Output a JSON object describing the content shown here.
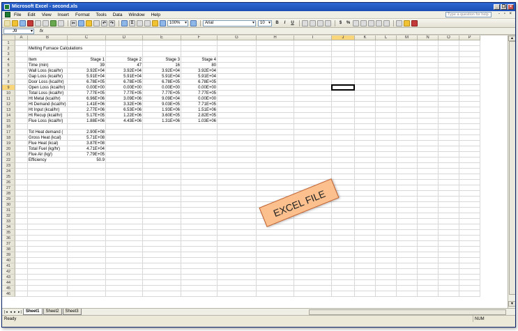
{
  "window": {
    "title": "Microsoft Excel - second.xls"
  },
  "menu": {
    "items": [
      "File",
      "Edit",
      "View",
      "Insert",
      "Format",
      "Tools",
      "Data",
      "Window",
      "Help"
    ],
    "help_placeholder": "Type a question for help"
  },
  "toolbar": {
    "zoom": "100%",
    "font": "Arial",
    "font_size": "10",
    "buttons": {
      "bold": "B",
      "italic": "I",
      "underline": "U",
      "currency": "$",
      "percent": "%"
    }
  },
  "formula_bar": {
    "name_box": "J9",
    "fx": "fx",
    "content": ""
  },
  "columns": [
    {
      "label": "A",
      "w": 18
    },
    {
      "label": "B",
      "w": 57
    },
    {
      "label": "C",
      "w": 55
    },
    {
      "label": "D",
      "w": 53
    },
    {
      "label": "E",
      "w": 55
    },
    {
      "label": "F",
      "w": 52
    },
    {
      "label": "G",
      "w": 56
    },
    {
      "label": "H",
      "w": 54
    },
    {
      "label": "I",
      "w": 54
    },
    {
      "label": "J",
      "w": 33
    },
    {
      "label": "K",
      "w": 30
    },
    {
      "label": "L",
      "w": 30
    },
    {
      "label": "M",
      "w": 30
    },
    {
      "label": "N",
      "w": 30
    },
    {
      "label": "O",
      "w": 30
    },
    {
      "label": "P",
      "w": 30
    }
  ],
  "selected": {
    "col": "J",
    "row": 9
  },
  "rows": [
    {
      "n": "1",
      "cells": [
        "",
        "",
        "",
        "",
        "",
        ""
      ]
    },
    {
      "n": "2",
      "cells": [
        "",
        "Melting Furnace Calculations",
        "",
        "",
        "",
        ""
      ]
    },
    {
      "n": "3",
      "cells": [
        "",
        "",
        "",
        "",
        "",
        ""
      ]
    },
    {
      "n": "4",
      "cells": [
        "",
        "Item",
        "Stage 1",
        "Stage 2",
        "Stage 3",
        "Stage 4"
      ]
    },
    {
      "n": "5",
      "cells": [
        "",
        "Time (min)",
        "39",
        "47",
        "16",
        "80"
      ]
    },
    {
      "n": "6",
      "cells": [
        "",
        "Wall Loss (kcal/hr)",
        "3.92E+04",
        "3.92E+04",
        "3.92E+04",
        "3.92E+04"
      ]
    },
    {
      "n": "7",
      "cells": [
        "",
        "Gap Loss (kcal/hr)",
        "5.91E+04",
        "5.91E+04",
        "5.91E+04",
        "5.91E+04"
      ]
    },
    {
      "n": "8",
      "cells": [
        "",
        "Door Loss (kcal/hr)",
        "6.78E+05",
        "6.78E+05",
        "6.78E+05",
        "6.78E+05"
      ]
    },
    {
      "n": "9",
      "cells": [
        "",
        "Open Loss (kcal/hr)",
        "0.00E+00",
        "0.00E+00",
        "0.00E+00",
        "0.00E+00"
      ]
    },
    {
      "n": "10",
      "cells": [
        "",
        "Total Loss (kcal/hr)",
        "7.77E+05",
        "7.77E+05",
        "7.77E+05",
        "7.77E+05"
      ]
    },
    {
      "n": "11",
      "cells": [
        "",
        "Ht Metal (kcal/hr)",
        "6.96E+06",
        "3.09E+06",
        "9.09E+04",
        "0.00E+00"
      ]
    },
    {
      "n": "12",
      "cells": [
        "",
        "Ht Demand (kcal/hr)",
        "1.41E+06",
        "3.32E+06",
        "9.03E+05",
        "7.71E+05"
      ]
    },
    {
      "n": "13",
      "cells": [
        "",
        "Ht Input (kcal/hr)",
        "2.77E+06",
        "6.53E+06",
        "1.93E+06",
        "1.51E+06"
      ]
    },
    {
      "n": "14",
      "cells": [
        "",
        "Ht Recup (kcal/hr)",
        "5.17E+05",
        "1.22E+06",
        "3.60E+05",
        "2.82E+05"
      ]
    },
    {
      "n": "15",
      "cells": [
        "",
        "Flue Loss (kcal/hr)",
        "1.88E+06",
        "4.43E+06",
        "1.31E+06",
        "1.03E+06"
      ]
    },
    {
      "n": "16",
      "cells": [
        "",
        "",
        "",
        "",
        "",
        ""
      ]
    },
    {
      "n": "17",
      "cells": [
        "",
        "Tot Heat demand (",
        "2.90E+08",
        "",
        "",
        ""
      ]
    },
    {
      "n": "18",
      "cells": [
        "",
        "Gross Heat (kcal)",
        "5.71E+08",
        "",
        "",
        ""
      ]
    },
    {
      "n": "19",
      "cells": [
        "",
        "Flue Heat (kcal)",
        "3.87E+08",
        "",
        "",
        ""
      ]
    },
    {
      "n": "20",
      "cells": [
        "",
        "Total Fuel (kg/hr)",
        "4.71E+04",
        "",
        "",
        ""
      ]
    },
    {
      "n": "21",
      "cells": [
        "",
        "Flue Air (kg/)",
        "7.79E+05",
        "",
        "",
        ""
      ]
    },
    {
      "n": "22",
      "cells": [
        "",
        "Efficiency",
        "50.9",
        "",
        "",
        ""
      ]
    }
  ],
  "total_rows": 46,
  "watermark": "EXCEL FILE",
  "sheets": [
    "Sheet1",
    "Sheet2",
    "Sheet3"
  ],
  "active_sheet": "Sheet1",
  "status": {
    "left": "Ready",
    "num": "NUM"
  }
}
